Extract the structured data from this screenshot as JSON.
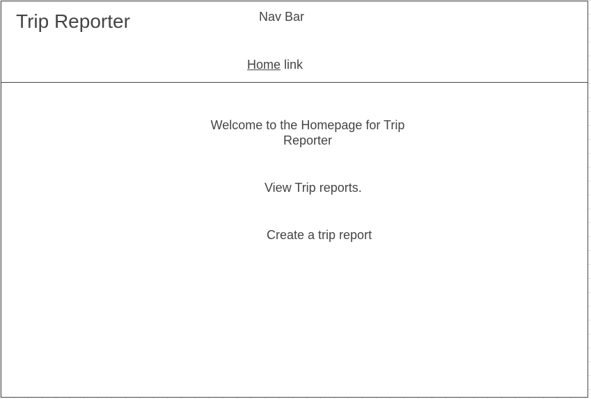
{
  "header": {
    "title": "Trip Reporter",
    "nav_label": "Nav Bar",
    "home_link": "Home",
    "home_link_suffix": " link"
  },
  "main": {
    "welcome": "Welcome to the Homepage for Trip Reporter",
    "view_reports": "View Trip reports.",
    "create_report": "Create a trip report"
  }
}
